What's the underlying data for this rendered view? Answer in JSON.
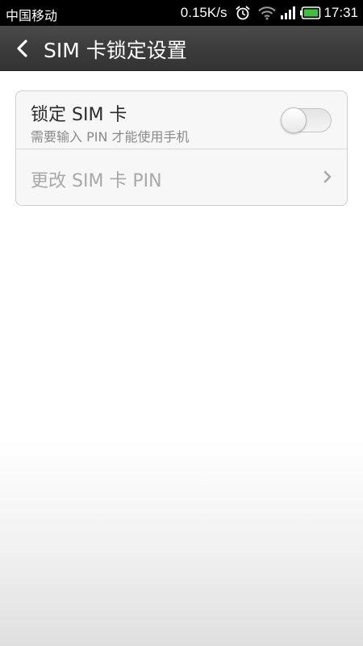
{
  "status_bar": {
    "carrier": "中国移动",
    "net_speed": "0.15K/s",
    "time": "17:31",
    "icons": [
      "alarm-icon",
      "wifi-icon",
      "signal-icon",
      "battery-icon"
    ],
    "battery_color": "#3fbf3f"
  },
  "title_bar": {
    "title": "SIM 卡锁定设置",
    "back_icon": "chevron-left-icon"
  },
  "settings": {
    "lock_sim": {
      "title": "锁定 SIM 卡",
      "subtitle": "需要输入 PIN 才能使用手机",
      "enabled": false
    },
    "change_pin": {
      "label": "更改 SIM 卡 PIN",
      "enabled": false,
      "icon": "chevron-right-icon"
    }
  }
}
